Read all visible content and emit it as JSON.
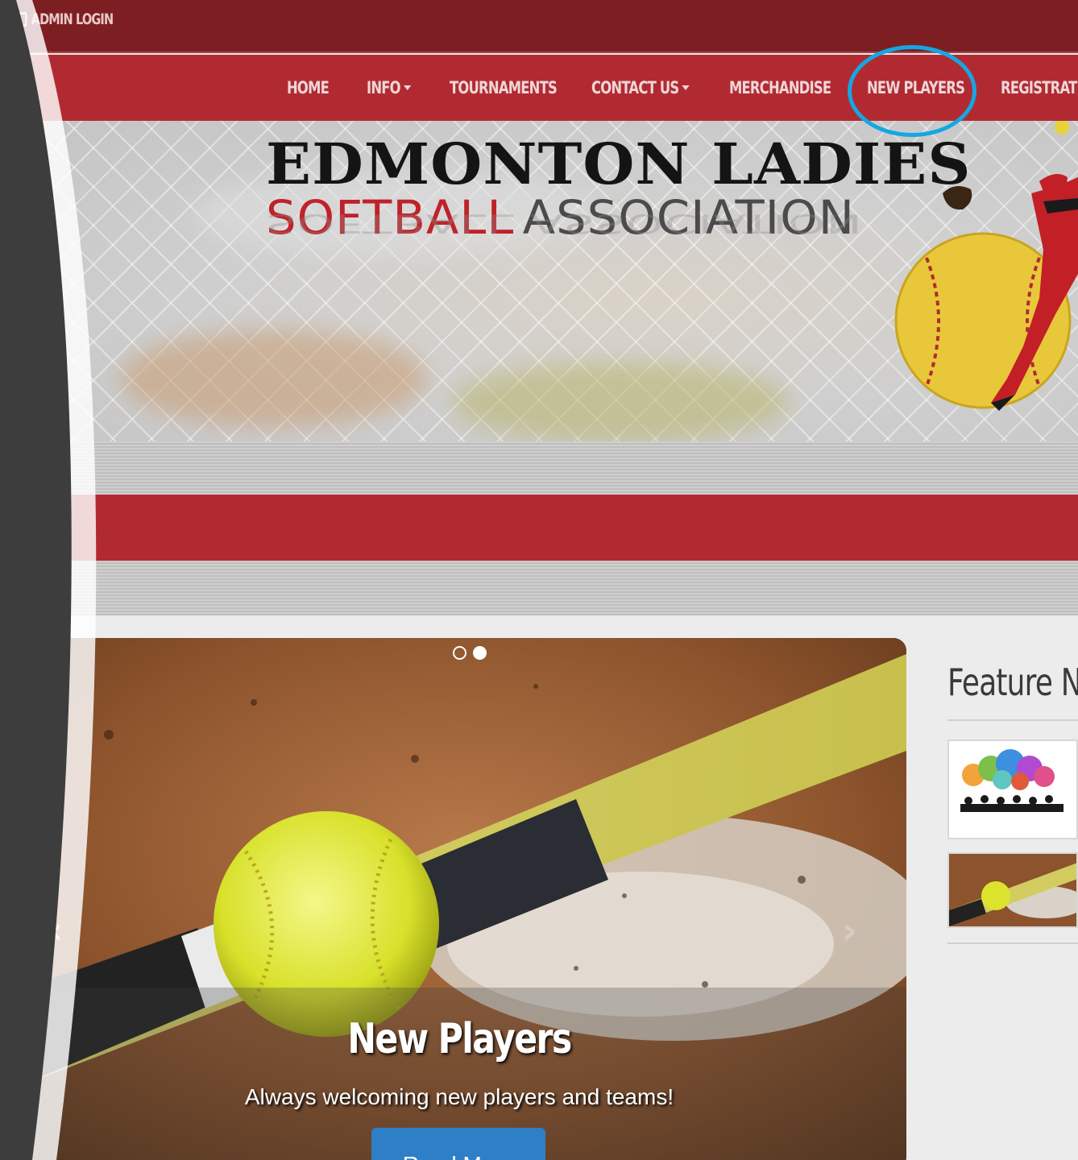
{
  "topbar": {
    "admin_login": "ADMIN LOGIN"
  },
  "nav": {
    "items": [
      {
        "label": "HOME",
        "has_dropdown": false
      },
      {
        "label": "INFO",
        "has_dropdown": true
      },
      {
        "label": "TOURNAMENTS",
        "has_dropdown": false
      },
      {
        "label": "CONTACT US",
        "has_dropdown": true
      },
      {
        "label": "MERCHANDISE",
        "has_dropdown": false
      },
      {
        "label": "NEW PLAYERS",
        "has_dropdown": false,
        "highlighted": true
      },
      {
        "label": "REGISTRATI",
        "has_dropdown": false
      }
    ],
    "highlight_color": "#14a7e3"
  },
  "banner": {
    "title_line_1": "EDMONTON LADIES",
    "title_line_2_part_1": "SOFTBALL",
    "title_line_2_part_2": "ASSOCIATION"
  },
  "carousel": {
    "slides_total": 2,
    "active_slide": 2,
    "caption_title": "New Players",
    "caption_text": "Always welcoming new players and teams!",
    "button_label": "Read More",
    "prev_icon": "chevron-left-icon",
    "next_icon": "chevron-right-icon"
  },
  "feature_news": {
    "title": "Feature N"
  },
  "colors": {
    "brand_red": "#b22a31",
    "dark_red": "#7d1e22",
    "button_blue": "#2f7fc6"
  }
}
